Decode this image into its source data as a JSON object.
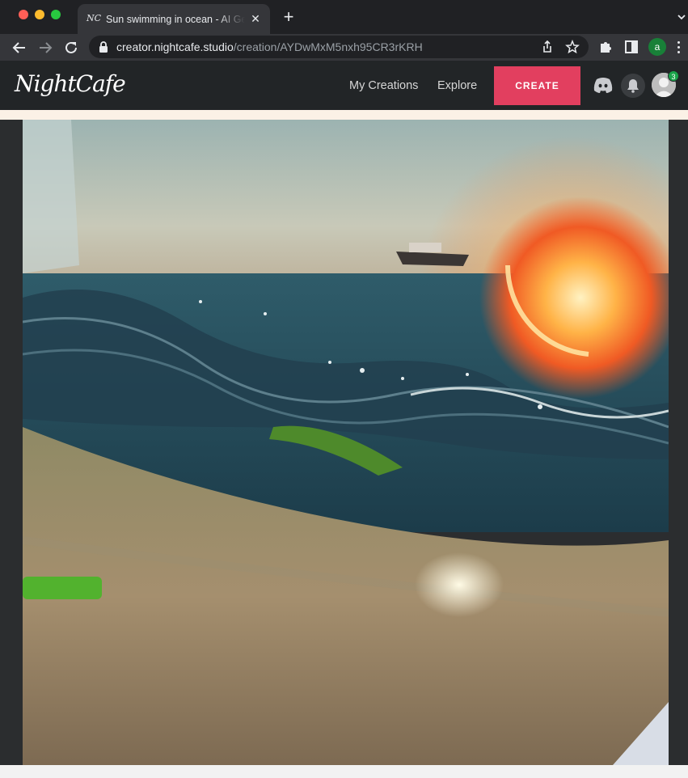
{
  "browser": {
    "tab": {
      "favicon_text": "NC",
      "title": "Sun swimming in ocean - AI Generated Artwork - NightCafe Creator",
      "close": "✕"
    },
    "new_tab": "+",
    "url": {
      "host": "creator.nightcafe.studio",
      "path": "/creation/AYDwMxM5nxh95CR3rKRH"
    },
    "profile_initial": "a"
  },
  "site": {
    "logo": "NightCafe",
    "nav": {
      "my_creations": "My Creations",
      "explore": "Explore",
      "create": "CREATE"
    },
    "notification_count": "3",
    "accent_color": "#e23f5f"
  },
  "creation": {
    "alt": "Sun swimming in ocean"
  }
}
